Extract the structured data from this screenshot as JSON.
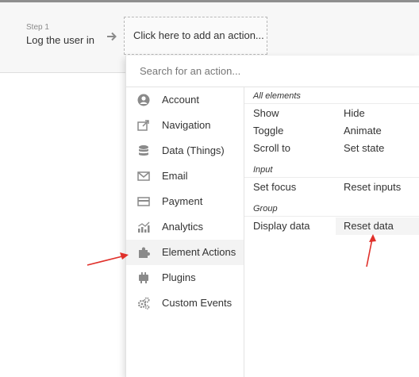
{
  "step": {
    "caption": "Step 1",
    "title": "Log the user in",
    "add_action_label": "Click here to add an action..."
  },
  "search": {
    "placeholder": "Search for an action..."
  },
  "categories": [
    {
      "label": "Account",
      "icon": "account-icon"
    },
    {
      "label": "Navigation",
      "icon": "navigation-icon"
    },
    {
      "label": "Data (Things)",
      "icon": "database-icon"
    },
    {
      "label": "Email",
      "icon": "email-icon"
    },
    {
      "label": "Payment",
      "icon": "credit-card-icon"
    },
    {
      "label": "Analytics",
      "icon": "analytics-icon"
    },
    {
      "label": "Element Actions",
      "icon": "puzzle-icon"
    },
    {
      "label": "Plugins",
      "icon": "plugin-icon"
    },
    {
      "label": "Custom Events",
      "icon": "gears-icon"
    }
  ],
  "sections": {
    "all_elements": {
      "title": "All elements",
      "actions": [
        "Show",
        "Hide",
        "Toggle",
        "Animate",
        "Scroll to",
        "Set state"
      ]
    },
    "input": {
      "title": "Input",
      "actions": [
        "Set focus",
        "Reset inputs"
      ]
    },
    "group": {
      "title": "Group",
      "actions": [
        "Display data",
        "Reset data"
      ]
    }
  },
  "colors": {
    "annotation_arrow": "#e0302a",
    "icon": "#8a8a8a",
    "active_bg": "#f3f3f3"
  }
}
